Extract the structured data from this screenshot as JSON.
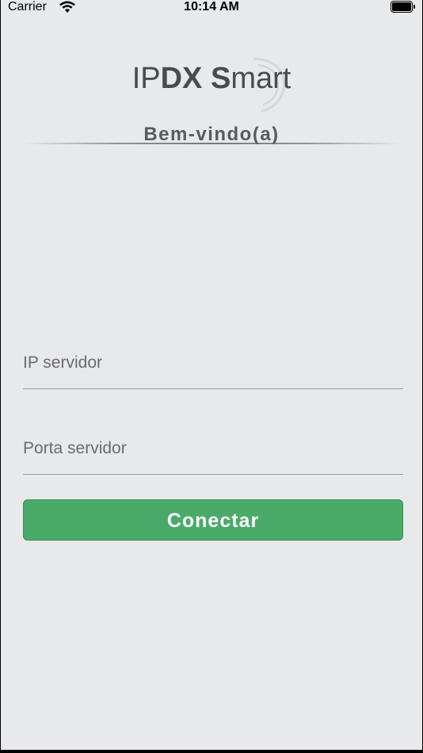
{
  "status_bar": {
    "carrier": "Carrier",
    "time": "10:14 AM"
  },
  "logo": {
    "part1": "IP",
    "part2": "DX",
    "part3": " ",
    "part4": "S",
    "part5": "mart"
  },
  "welcome": "Bem-vindo(a)",
  "form": {
    "ip_placeholder": "IP servidor",
    "ip_value": "",
    "port_placeholder": "Porta servidor",
    "port_value": "",
    "connect_label": "Conectar"
  },
  "colors": {
    "background": "#e8e9eb",
    "button": "#4aaa6a",
    "text_dark": "#4a4b4d"
  }
}
